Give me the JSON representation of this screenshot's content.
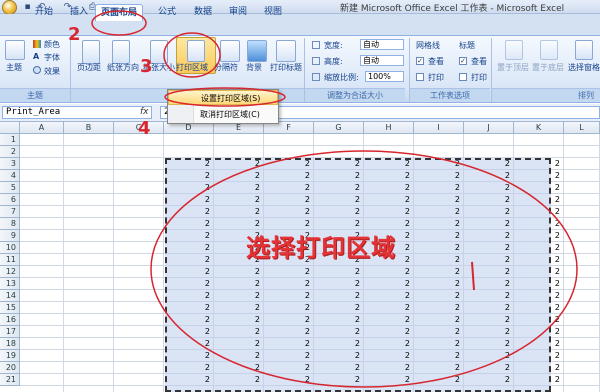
{
  "window": {
    "title": "新建 Microsoft Office Excel 工作表 - Microsoft Excel"
  },
  "quick_access": {
    "save_icon": "save-icon",
    "undo_icon": "undo-icon",
    "redo_icon": "redo-icon",
    "preview_icon": "print-preview-icon"
  },
  "tabs": [
    {
      "label": "开始"
    },
    {
      "label": "插入"
    },
    {
      "label": "页面布局"
    },
    {
      "label": "公式"
    },
    {
      "label": "数据"
    },
    {
      "label": "审阅"
    },
    {
      "label": "视图"
    }
  ],
  "ribbon": {
    "theme_group": {
      "label": "主题",
      "theme_btn": "主题",
      "colors": "颜色",
      "fonts": "字体",
      "effects": "效果"
    },
    "page_setup": {
      "margins": "页边距",
      "orientation": "纸张方向",
      "size": "纸张大小",
      "print_area": "打印区域",
      "breaks": "分隔符",
      "background": "背景",
      "print_titles": "打印标题"
    },
    "scale_group": {
      "label": "调整为合适大小",
      "width_label": "宽度:",
      "width_value": "自动",
      "height_label": "高度:",
      "height_value": "自动",
      "scale_label": "缩放比例:",
      "scale_value": "100%"
    },
    "sheet_options": {
      "label": "工作表选项",
      "gridlines": "网格线",
      "headings": "标题",
      "view1": "查看",
      "print1": "打印",
      "view2": "查看",
      "print2": "打印"
    },
    "arrange": {
      "label": "排列",
      "bring_front": "置于顶层",
      "send_back": "置于底层",
      "selection_pane": "选择窗格"
    }
  },
  "dropdown_menu": {
    "set_print_area": "设置打印区域(S)",
    "clear_print_area": "取消打印区域(C)"
  },
  "formula_bar": {
    "name_box": "Print_Area",
    "fx": "fx",
    "value": "2"
  },
  "columns": [
    "A",
    "B",
    "C",
    "D",
    "E",
    "F",
    "G",
    "H",
    "I",
    "J",
    "K",
    "L"
  ],
  "rows": [
    "1",
    "2",
    "3",
    "4",
    "5",
    "6",
    "7",
    "8",
    "9",
    "10",
    "11",
    "12",
    "13",
    "14",
    "15",
    "16",
    "17",
    "18",
    "19",
    "20",
    "21"
  ],
  "cell_value": "2",
  "annotations": {
    "step2": "2",
    "step3": "3",
    "step4": "4",
    "big_text": "选择打印区域"
  },
  "colors": {
    "annotation_red": "#d8262f",
    "selection_fill": "#bccdec",
    "ribbon_blue": "#dbe7f7"
  }
}
